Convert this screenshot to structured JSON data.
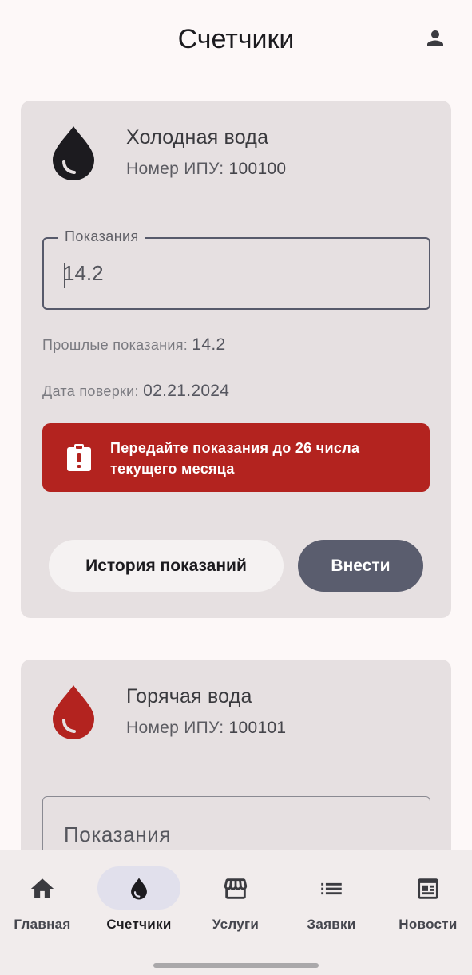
{
  "header": {
    "title": "Счетчики",
    "profile_icon": "person-icon"
  },
  "meters": [
    {
      "name": "Холодная вода",
      "id_label": "Номер ИПУ:",
      "id_value": "100100",
      "icon": "water-drop-icon",
      "icon_color": "#1c1b1f",
      "field_label": "Показания",
      "field_value": "14.2",
      "prev_label": "Прошлые показания:",
      "prev_value": "14.2",
      "verify_label": "Дата поверки:",
      "verify_value": "02.21.2024",
      "alert_text": "Передайте показания до 26 числа текущего месяца",
      "alert_color": "#b3231f",
      "history_button": "История показаний",
      "submit_button": "Внести"
    },
    {
      "name": "Горячая вода",
      "id_label": "Номер ИПУ:",
      "id_value": "100101",
      "icon": "water-drop-icon",
      "icon_color": "#b3231f",
      "field_placeholder": "Показания"
    }
  ],
  "nav": {
    "items": [
      {
        "label": "Главная",
        "icon": "home-icon"
      },
      {
        "label": "Счетчики",
        "icon": "water-drop-icon",
        "active": true
      },
      {
        "label": "Услуги",
        "icon": "store-icon"
      },
      {
        "label": "Заявки",
        "icon": "list-icon"
      },
      {
        "label": "Новости",
        "icon": "newspaper-icon"
      }
    ]
  },
  "colors": {
    "background": "#fdf8f8",
    "card": "#e6e0e1",
    "primary_button": "#5a5d6e",
    "active_nav_pill": "#e1e0ec"
  }
}
